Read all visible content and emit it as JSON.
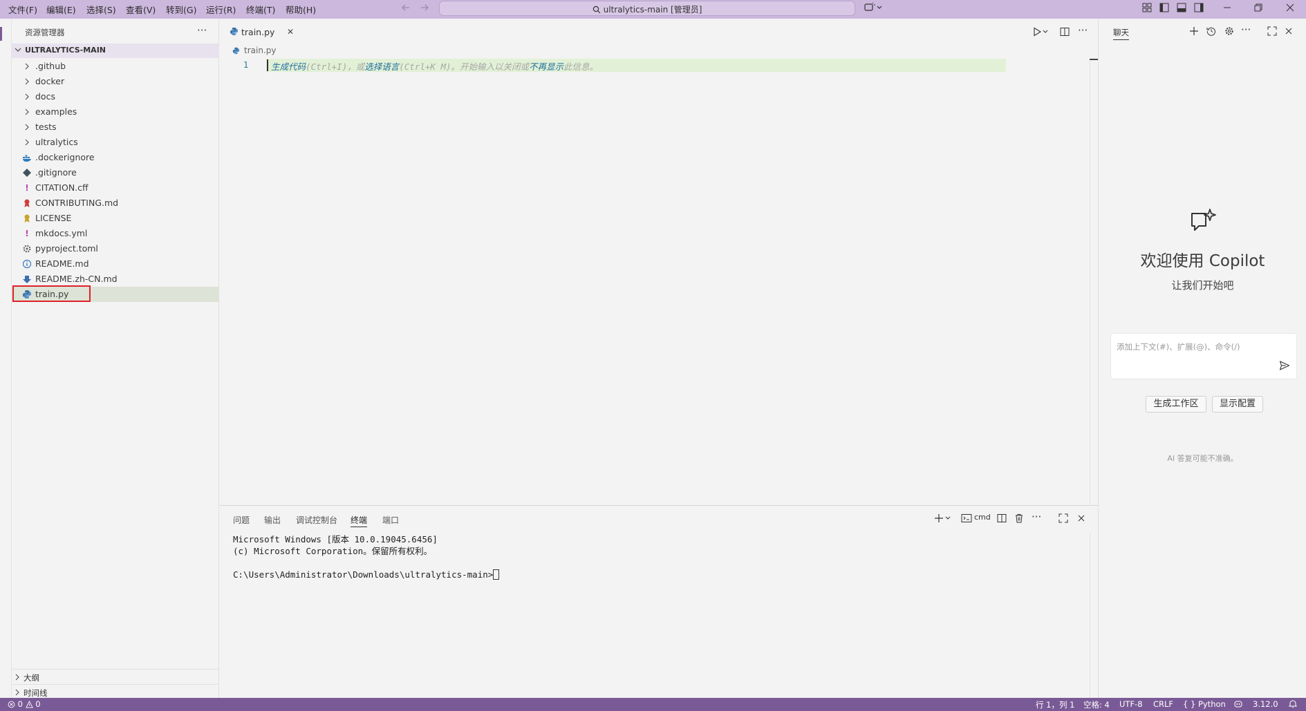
{
  "menu": [
    "文件(F)",
    "编辑(E)",
    "选择(S)",
    "查看(V)",
    "转到(G)",
    "运行(R)",
    "终端(T)",
    "帮助(H)"
  ],
  "search": {
    "text": "ultralytics-main [管理员]"
  },
  "sidebar": {
    "title": "资源管理器",
    "root": "ULTRALYTICS-MAIN",
    "folders": [
      ".github",
      "docker",
      "docs",
      "examples",
      "tests",
      "ultralytics"
    ],
    "files": [
      {
        "name": ".dockerignore",
        "icon": "docker-icon",
        "color": "#2b7bbd"
      },
      {
        "name": ".gitignore",
        "icon": "git-icon",
        "color": "#41535b"
      },
      {
        "name": "CITATION.cff",
        "icon": "exclamation-icon",
        "color": "#b542b0"
      },
      {
        "name": "CONTRIBUTING.md",
        "icon": "ribbon-icon",
        "color": "#d43b3b"
      },
      {
        "name": "LICENSE",
        "icon": "license-icon",
        "color": "#c9a227"
      },
      {
        "name": "mkdocs.yml",
        "icon": "exclamation-icon",
        "color": "#b542b0"
      },
      {
        "name": "pyproject.toml",
        "icon": "gear-icon",
        "color": "#666666"
      },
      {
        "name": "README.md",
        "icon": "info-icon",
        "color": "#3a78c3"
      },
      {
        "name": "README.zh-CN.md",
        "icon": "download-arrow-icon",
        "color": "#3a6fb0"
      },
      {
        "name": "train.py",
        "icon": "python-icon",
        "color": "#3572a5"
      }
    ],
    "outline": "大纲",
    "timeline": "时间线"
  },
  "editor": {
    "tab": "train.py",
    "breadcrumb": "train.py",
    "line_number": "1",
    "hint": {
      "link1": "生成代码",
      "part1": "(Ctrl+I)，或",
      "link2": "选择语言",
      "part2": "(Ctrl+K M)。开始输入以关闭或",
      "link3": "不再显示",
      "part3": "此信息。"
    }
  },
  "panel": {
    "tabs": [
      "问题",
      "输出",
      "调试控制台",
      "终端",
      "端口"
    ],
    "active_tab": "终端",
    "shell": "cmd",
    "terminal_lines": [
      "Microsoft Windows [版本 10.0.19045.6456]",
      "(c) Microsoft Corporation。保留所有权利。",
      "",
      "C:\\Users\\Administrator\\Downloads\\ultralytics-main>"
    ]
  },
  "chat": {
    "title": "聊天",
    "welcome": "欢迎使用 Copilot",
    "subtitle": "让我们开始吧",
    "placeholder": "添加上下文(#)、扩展(@)、命令(/)",
    "btn_workspace": "生成工作区",
    "btn_config": "显示配置",
    "note": "AI 答复可能不准确。"
  },
  "status": {
    "errors": "0",
    "warnings": "0",
    "position": "行 1，列 1",
    "spaces": "空格: 4",
    "encoding": "UTF-8",
    "eol": "CRLF",
    "language": "{ } Python",
    "version": "3.12.0"
  },
  "colors": {
    "titlebar": "#ccb7dd",
    "statusbar": "#7a5a96",
    "selection": "#dde3d6",
    "highlight_line": "#e2f1d6",
    "link": "#226f9e"
  }
}
